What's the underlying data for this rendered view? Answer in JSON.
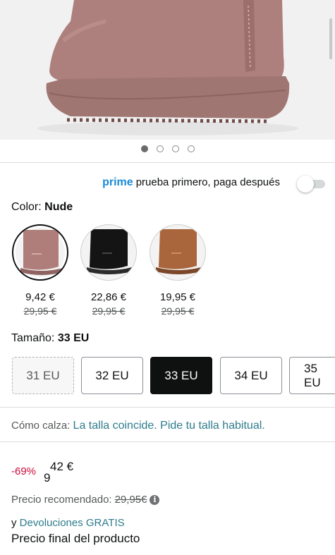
{
  "gallery": {
    "dot_count": 4,
    "active_index": 0
  },
  "prime": {
    "logo": "prime",
    "text": "prueba primero, paga después",
    "toggle_on": false
  },
  "color": {
    "label": "Color:",
    "value": "Nude",
    "options": [
      {
        "name": "Nude",
        "shade": "#b07e7a",
        "price": "9,42 €",
        "list_price": "29,95 €",
        "selected": true
      },
      {
        "name": "Negro",
        "shade": "#141414",
        "price": "22,86 €",
        "list_price": "29,95 €",
        "selected": false
      },
      {
        "name": "Castaño",
        "shade": "#a9653c",
        "price": "19,95 €",
        "list_price": "29,95 €",
        "selected": false
      }
    ]
  },
  "size": {
    "label": "Tamaño:",
    "value": "33 EU",
    "options": [
      {
        "label": "31 EU",
        "state": "unavailable"
      },
      {
        "label": "32 EU",
        "state": "available"
      },
      {
        "label": "33 EU",
        "state": "selected"
      },
      {
        "label": "34 EU",
        "state": "available"
      },
      {
        "label": "35 EU",
        "state": "available"
      }
    ]
  },
  "fit": {
    "label": "Cómo calza:",
    "text": "La talla coincide. Pide tu talla habitual."
  },
  "pricing": {
    "discount": "-69%",
    "price_whole": "9",
    "price_fraction": "42 €",
    "recommended_label": "Precio recomendado:",
    "recommended_price": "29,95€",
    "returns_prefix": "y",
    "returns_link": "Devoluciones GRATIS",
    "final_text": "Precio final del producto"
  },
  "colors": {
    "accent_link": "#2e7c8c",
    "prime_blue": "#1a8bd6",
    "discount_red": "#cc0c39"
  }
}
